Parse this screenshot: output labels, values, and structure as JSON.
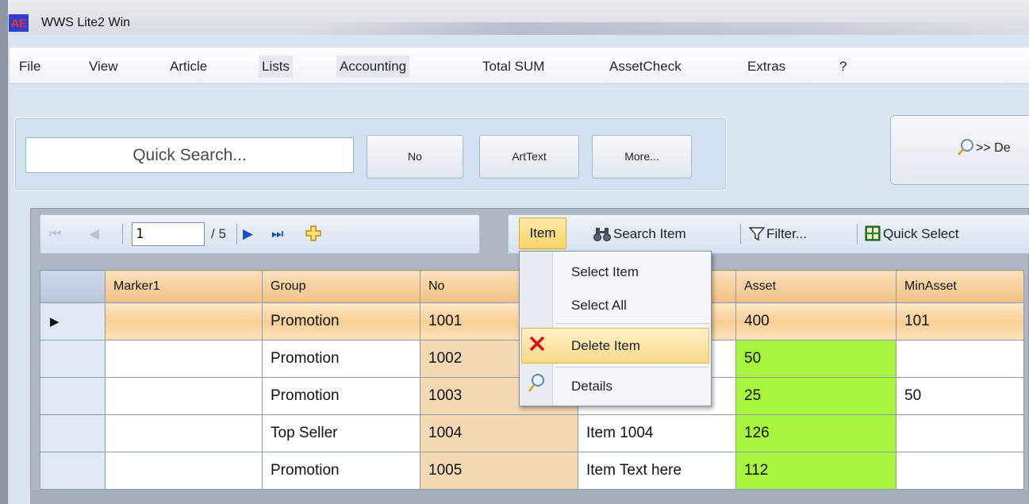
{
  "window": {
    "title": "WWS Lite2 Win",
    "logo_text": "AE"
  },
  "menu": [
    "File",
    "View",
    "Article",
    "Lists",
    "Accounting",
    "Total SUM",
    "AssetCheck",
    "Extras",
    "?"
  ],
  "search": {
    "placeholder": "Quick Search...",
    "buttons": [
      "No",
      "ArtText",
      "More..."
    ],
    "detail_button": ">> De"
  },
  "navigator": {
    "page": "1",
    "total": "/ 5"
  },
  "toolbar": {
    "item": "Item",
    "search_item": "Search Item",
    "filter": "Filter...",
    "quick_select": "Quick Select"
  },
  "popup_menu": [
    "Select Item",
    "Select All",
    "Delete Item",
    "Details"
  ],
  "grid": {
    "columns": [
      "Marker1",
      "Group",
      "No",
      "",
      "Asset",
      "MinAsset"
    ],
    "rows": [
      {
        "marker": "",
        "group": "Promotion",
        "no": "1001",
        "text": "",
        "asset": "400",
        "min_asset": "101"
      },
      {
        "marker": "",
        "group": "Promotion",
        "no": "1002",
        "text": "",
        "asset": "50",
        "min_asset": ""
      },
      {
        "marker": "",
        "group": "Promotion",
        "no": "1003",
        "text": "",
        "asset": "25",
        "min_asset": "50"
      },
      {
        "marker": "",
        "group": "Top Seller",
        "no": "1004",
        "text": "Item 1004",
        "asset": "126",
        "min_asset": ""
      },
      {
        "marker": "",
        "group": "Promotion",
        "no": "1005",
        "text": "Item Text here",
        "asset": "112",
        "min_asset": ""
      }
    ]
  },
  "colors": {
    "accent_orange": "#f3c185",
    "asset_green": "#a8f53e",
    "no_column": "#f4d9b2",
    "popup_highlight": "#f9d98a",
    "delete_icon": "#e01010"
  },
  "icons": [
    "first-page-icon",
    "prev-page-icon",
    "next-page-icon",
    "last-page-icon",
    "add-icon",
    "binoculars-icon",
    "filter-icon",
    "grid-icon",
    "magnifier-icon",
    "delete-x-icon",
    "row-pointer-icon"
  ]
}
